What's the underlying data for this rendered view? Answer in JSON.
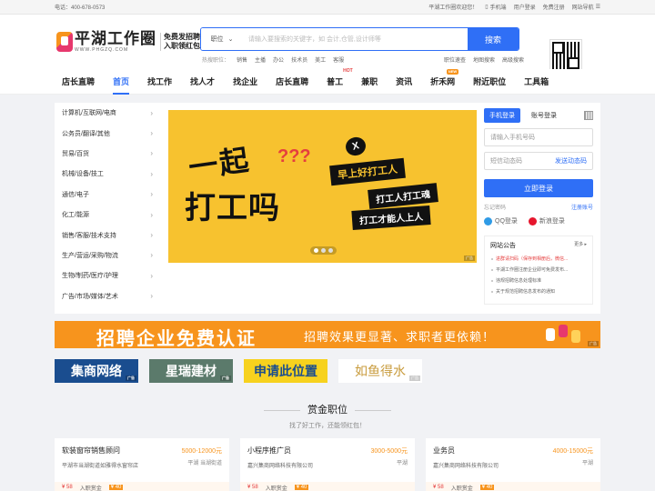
{
  "topbar": {
    "phone": "电话：400-678-0573",
    "welcome": "平湖工作圈欢迎您！",
    "mobile": "手机端",
    "login": "用户登录",
    "register": "免费注册",
    "sitenav": "网站导航"
  },
  "logo": {
    "name": "平湖工作圈",
    "url": "WWW.PHGZQ.COM",
    "slogan1": "免费发招聘",
    "slogan2": "入职领红包"
  },
  "search": {
    "select": "职位",
    "placeholder": "请输入要搜索的关键字，如 会计,仓管,设计师等",
    "button": "搜索",
    "hot_label": "热搜职位：",
    "hot": [
      "销售",
      "主播",
      "办公",
      "技术员",
      "美工",
      "客服"
    ],
    "links": [
      "职位速查",
      "地图搜索",
      "高级搜索"
    ]
  },
  "nav": {
    "items": [
      "店长直聘",
      "首页",
      "找工作",
      "找人才",
      "找企业",
      "店长直聘",
      "普工",
      "兼职",
      "资讯",
      "折禾网",
      "附近职位",
      "工具箱"
    ],
    "hot_badge": "HOT",
    "new_badge": "NEW"
  },
  "categories": [
    "计算机/互联网/电商",
    "公务员/翻译/其他",
    "贸易/百货",
    "机械/设备/技工",
    "通信/电子",
    "化工/能源",
    "销售/客服/技术支持",
    "生产/营运/采购/物流",
    "生物/制药/医疗/护理",
    "广告/市场/媒体/艺术"
  ],
  "banner": {
    "big1": "一起",
    "big2": "打工吗",
    "q": "???",
    "x": "X",
    "tag1": "早上好打工人",
    "tag2": "打工人打工魂",
    "tag3": "打工才能人上人",
    "ad": "广告"
  },
  "login": {
    "tab_phone": "手机登录",
    "tab_account": "账号登录",
    "phone_ph": "请输入手机号码",
    "code_ph": "短信动态码",
    "send_code": "发送动态码",
    "submit": "立即登录",
    "forgot": "忘记密码",
    "register": "注册账号",
    "qq": "QQ登录",
    "weibo": "新浪登录"
  },
  "notice": {
    "title": "网站公告",
    "more": "更多",
    "items": [
      "进群请扫码（保存到相册后，微信...",
      "平湖工作圈注册企业即可免费发布...",
      "违规招聘信息处理标准",
      "关于规范招聘信息发布的通知"
    ]
  },
  "promo": {
    "main": "招聘企业免费认证",
    "sub": "招聘效果更显著、求职者更依赖！",
    "ad": "广告"
  },
  "ads": [
    {
      "text": "集商网络",
      "ad": "广告"
    },
    {
      "text": "星瑞建材",
      "ad": "广告"
    },
    {
      "text": "申请此位置",
      "ad": ""
    },
    {
      "text": "如鱼得水",
      "ad": "广告"
    }
  ],
  "section": {
    "title": "赏金职位",
    "sub": "找了好工作，还能领红包！"
  },
  "jobs": [
    {
      "title": "软装窗帘销售顾问",
      "salary": "5000-12000元",
      "loc": "平湖 当湖街道",
      "company": "平湖市当湖街道如雅得水窗帘店",
      "bonus": "¥ 58",
      "reward": "入职赏金",
      "tag": "¥ 40"
    },
    {
      "title": "小程序推广员",
      "salary": "3000-5000元",
      "loc": "平湖",
      "company": "嘉兴集商网络科技有限公司",
      "bonus": "¥ 58",
      "reward": "入职赏金",
      "tag": "¥ 40"
    },
    {
      "title": "业务员",
      "salary": "4000-15000元",
      "loc": "平湖",
      "company": "嘉兴集商网络科技有限公司",
      "bonus": "¥ 58",
      "reward": "入职赏金",
      "tag": "¥ 40"
    }
  ],
  "colors": {
    "primary": "#2f6ff6",
    "orange": "#f7941d",
    "banner": "#f7c22f"
  }
}
